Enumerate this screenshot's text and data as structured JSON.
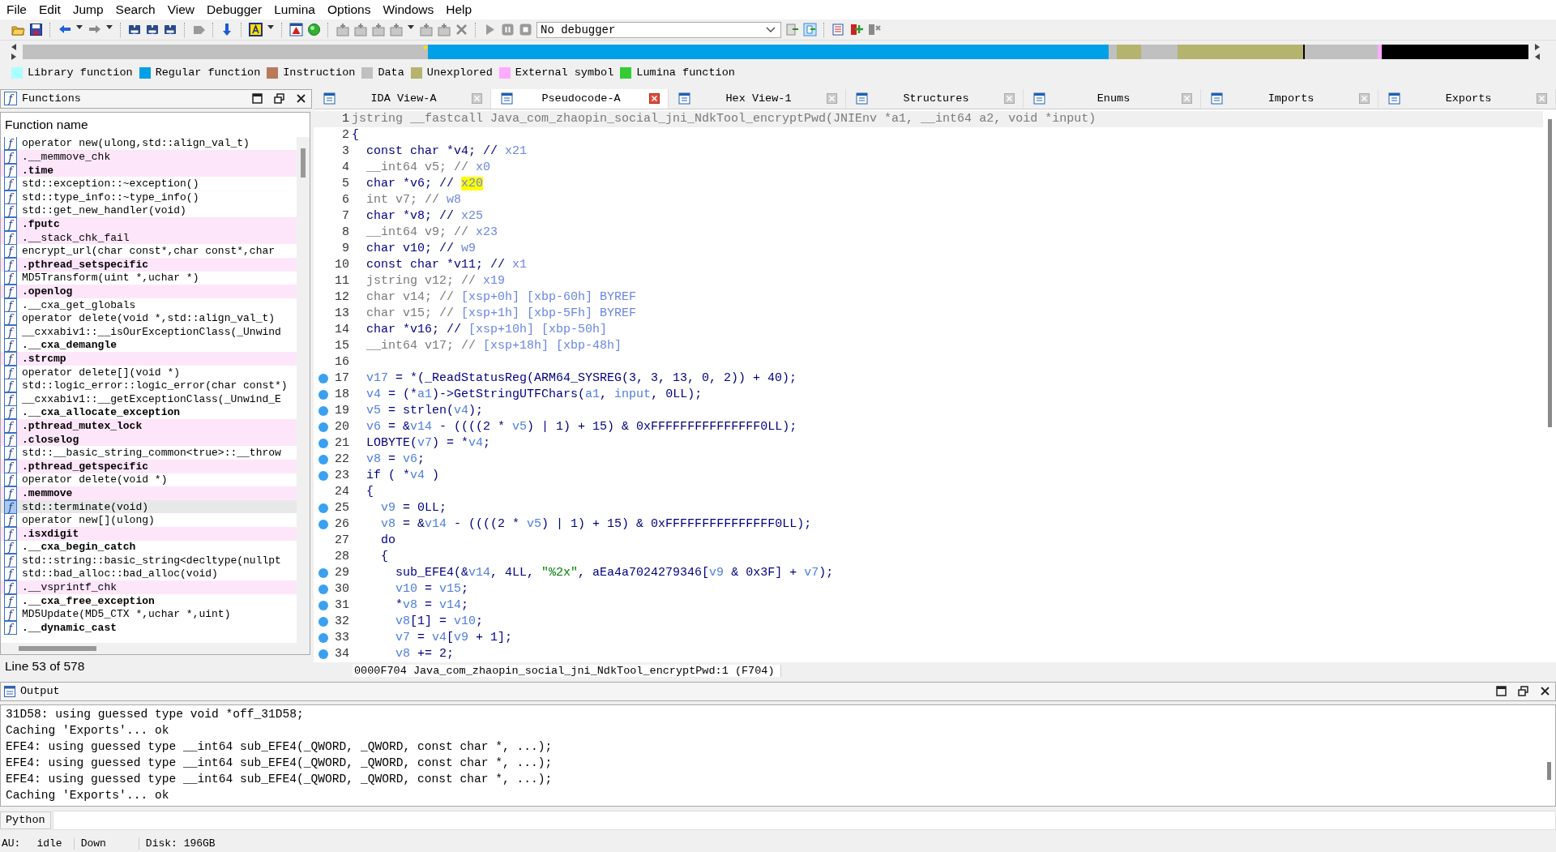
{
  "menu": [
    "File",
    "Edit",
    "Jump",
    "Search",
    "View",
    "Debugger",
    "Lumina",
    "Options",
    "Windows",
    "Help"
  ],
  "toolbar": {
    "debugger_select": "No debugger"
  },
  "legend": [
    {
      "label": "Library function",
      "color": "#aaffff"
    },
    {
      "label": "Regular function",
      "color": "#00a0e6"
    },
    {
      "label": "Instruction",
      "color": "#b87a5a"
    },
    {
      "label": "Data",
      "color": "#c0c0c0"
    },
    {
      "label": "Unexplored",
      "color": "#b4b46e"
    },
    {
      "label": "External symbol",
      "color": "#ffaaff"
    },
    {
      "label": "Lumina function",
      "color": "#33cc33"
    }
  ],
  "functions_panel": {
    "title_icon": "f",
    "title": "Functions",
    "column": "Function name",
    "status": "Line 53 of 578",
    "rows": [
      {
        "icon": "f",
        "name": "operator new(ulong,std::align_val_t)",
        "external": false,
        "bold": false,
        "selected": false
      },
      {
        "icon": "f",
        "name": ".__memmove_chk",
        "external": true,
        "bold": false,
        "selected": false
      },
      {
        "icon": "f",
        "name": ".time",
        "external": true,
        "bold": true,
        "selected": false
      },
      {
        "icon": "f",
        "name": "std::exception::~exception()",
        "external": false,
        "bold": false,
        "selected": false
      },
      {
        "icon": "f",
        "name": "std::type_info::~type_info()",
        "external": false,
        "bold": false,
        "selected": false
      },
      {
        "icon": "f",
        "name": "std::get_new_handler(void)",
        "external": false,
        "bold": false,
        "selected": false
      },
      {
        "icon": "f",
        "name": ".fputc",
        "external": true,
        "bold": true,
        "selected": false
      },
      {
        "icon": "f",
        "name": ".__stack_chk_fail",
        "external": true,
        "bold": false,
        "selected": false
      },
      {
        "icon": "f",
        "name": "encrypt_url(char const*,char const*,char",
        "external": false,
        "bold": false,
        "selected": false
      },
      {
        "icon": "f",
        "name": ".pthread_setspecific",
        "external": true,
        "bold": true,
        "selected": false
      },
      {
        "icon": "f",
        "name": "MD5Transform(uint *,uchar *)",
        "external": false,
        "bold": false,
        "selected": false
      },
      {
        "icon": "f",
        "name": ".openlog",
        "external": true,
        "bold": true,
        "selected": false
      },
      {
        "icon": "f",
        "name": ".__cxa_get_globals",
        "external": false,
        "bold": false,
        "selected": false
      },
      {
        "icon": "f",
        "name": "operator delete(void *,std::align_val_t)",
        "external": false,
        "bold": false,
        "selected": false
      },
      {
        "icon": "f",
        "name": "__cxxabiv1::__isOurExceptionClass(_Unwind",
        "external": false,
        "bold": false,
        "selected": false
      },
      {
        "icon": "f",
        "name": ".__cxa_demangle",
        "external": false,
        "bold": true,
        "selected": false
      },
      {
        "icon": "f",
        "name": ".strcmp",
        "external": true,
        "bold": true,
        "selected": false
      },
      {
        "icon": "f",
        "name": "operator delete[](void *)",
        "external": false,
        "bold": false,
        "selected": false
      },
      {
        "icon": "f",
        "name": "std::logic_error::logic_error(char const*)",
        "external": false,
        "bold": false,
        "selected": false
      },
      {
        "icon": "f",
        "name": "__cxxabiv1::__getExceptionClass(_Unwind_E",
        "external": false,
        "bold": false,
        "selected": false
      },
      {
        "icon": "f",
        "name": ".__cxa_allocate_exception",
        "external": false,
        "bold": true,
        "selected": false
      },
      {
        "icon": "f",
        "name": ".pthread_mutex_lock",
        "external": true,
        "bold": true,
        "selected": false
      },
      {
        "icon": "f",
        "name": ".closelog",
        "external": true,
        "bold": true,
        "selected": false
      },
      {
        "icon": "f",
        "name": "std::__basic_string_common<true>::__throw",
        "external": false,
        "bold": false,
        "selected": false
      },
      {
        "icon": "f",
        "name": ".pthread_getspecific",
        "external": true,
        "bold": true,
        "selected": false
      },
      {
        "icon": "f",
        "name": "operator delete(void *)",
        "external": false,
        "bold": false,
        "selected": false
      },
      {
        "icon": "f",
        "name": ".memmove",
        "external": true,
        "bold": true,
        "selected": false
      },
      {
        "icon": "f",
        "name": "std::terminate(void)",
        "external": false,
        "bold": false,
        "selected": true
      },
      {
        "icon": "f",
        "name": "operator new[](ulong)",
        "external": false,
        "bold": false,
        "selected": false
      },
      {
        "icon": "f",
        "name": ".isxdigit",
        "external": true,
        "bold": true,
        "selected": false
      },
      {
        "icon": "f",
        "name": ".__cxa_begin_catch",
        "external": false,
        "bold": true,
        "selected": false
      },
      {
        "icon": "f",
        "name": "std::string::basic_string<decltype(nullpt",
        "external": false,
        "bold": false,
        "selected": false
      },
      {
        "icon": "f",
        "name": "std::bad_alloc::bad_alloc(void)",
        "external": false,
        "bold": false,
        "selected": false
      },
      {
        "icon": "f",
        "name": ".__vsprintf_chk",
        "external": true,
        "bold": false,
        "selected": false
      },
      {
        "icon": "f",
        "name": ".__cxa_free_exception",
        "external": false,
        "bold": true,
        "selected": false
      },
      {
        "icon": "f",
        "name": "MD5Update(MD5_CTX *,uchar *,uint)",
        "external": false,
        "bold": false,
        "selected": false
      },
      {
        "icon": "f",
        "name": ".__dynamic_cast",
        "external": false,
        "bold": true,
        "selected": false
      }
    ]
  },
  "tabs": [
    {
      "label": "IDA View-A",
      "selected": false
    },
    {
      "label": "Pseudocode-A",
      "selected": true
    },
    {
      "label": "Hex View-1",
      "selected": false
    },
    {
      "label": "Structures",
      "selected": false
    },
    {
      "label": "Enums",
      "selected": false
    },
    {
      "label": "Imports",
      "selected": false
    },
    {
      "label": "Exports",
      "selected": false
    }
  ],
  "pseudocode": {
    "status": "0000F704 Java_com_zhaopin_social_jni_NdkTool_encryptPwd:1 (F704)",
    "lines": [
      {
        "number": "1",
        "breakpoint": false,
        "current": true,
        "segments": [
          {
            "kind": "g",
            "text": "jstring __fastcall Java_com_zhaopin_social_jni_NdkTool_encryptPwd(JNIEnv *a1, __int64 a2, void *input)"
          }
        ]
      },
      {
        "number": "2",
        "breakpoint": false,
        "current": false,
        "segments": [
          {
            "kind": "n",
            "text": "{"
          }
        ]
      },
      {
        "number": "3",
        "breakpoint": false,
        "current": false,
        "segments": [
          {
            "kind": "n",
            "text": "  const char *v4; // "
          },
          {
            "kind": "c",
            "text": "x21"
          }
        ]
      },
      {
        "number": "4",
        "breakpoint": false,
        "current": false,
        "segments": [
          {
            "kind": "g",
            "text": "  __int64 v5; // "
          },
          {
            "kind": "c",
            "text": "x0"
          }
        ]
      },
      {
        "number": "5",
        "breakpoint": false,
        "current": false,
        "segments": [
          {
            "kind": "n",
            "text": "  char *v6; // "
          },
          {
            "kind": "h",
            "text": "x20"
          }
        ]
      },
      {
        "number": "6",
        "breakpoint": false,
        "current": false,
        "segments": [
          {
            "kind": "g",
            "text": "  int v7; // "
          },
          {
            "kind": "c",
            "text": "w8"
          }
        ]
      },
      {
        "number": "7",
        "breakpoint": false,
        "current": false,
        "segments": [
          {
            "kind": "n",
            "text": "  char *v8; // "
          },
          {
            "kind": "c",
            "text": "x25"
          }
        ]
      },
      {
        "number": "8",
        "breakpoint": false,
        "current": false,
        "segments": [
          {
            "kind": "g",
            "text": "  __int64 v9; // "
          },
          {
            "kind": "c",
            "text": "x23"
          }
        ]
      },
      {
        "number": "9",
        "breakpoint": false,
        "current": false,
        "segments": [
          {
            "kind": "n",
            "text": "  char v10; // "
          },
          {
            "kind": "c",
            "text": "w9"
          }
        ]
      },
      {
        "number": "10",
        "breakpoint": false,
        "current": false,
        "segments": [
          {
            "kind": "n",
            "text": "  const char *v11; // "
          },
          {
            "kind": "c",
            "text": "x1"
          }
        ]
      },
      {
        "number": "11",
        "breakpoint": false,
        "current": false,
        "segments": [
          {
            "kind": "g",
            "text": "  jstring v12; // "
          },
          {
            "kind": "c",
            "text": "x19"
          }
        ]
      },
      {
        "number": "12",
        "breakpoint": false,
        "current": false,
        "segments": [
          {
            "kind": "g",
            "text": "  char v14; // "
          },
          {
            "kind": "c",
            "text": "[xsp+0h] [xbp-60h] BYREF"
          }
        ]
      },
      {
        "number": "13",
        "breakpoint": false,
        "current": false,
        "segments": [
          {
            "kind": "g",
            "text": "  char v15; // "
          },
          {
            "kind": "c",
            "text": "[xsp+1h] [xbp-5Fh] BYREF"
          }
        ]
      },
      {
        "number": "14",
        "breakpoint": false,
        "current": false,
        "segments": [
          {
            "kind": "n",
            "text": "  char *v16; // "
          },
          {
            "kind": "c",
            "text": "[xsp+10h] [xbp-50h]"
          }
        ]
      },
      {
        "number": "15",
        "breakpoint": false,
        "current": false,
        "segments": [
          {
            "kind": "g",
            "text": "  __int64 v17; // "
          },
          {
            "kind": "c",
            "text": "[xsp+18h] [xbp-48h]"
          }
        ]
      },
      {
        "number": "16",
        "breakpoint": false,
        "current": false
      },
      {
        "number": "17",
        "breakpoint": true,
        "current": false,
        "segments": [
          {
            "kind": "v",
            "text": "  v17"
          },
          {
            "kind": "n",
            "text": " = *(_ReadStatusReg(ARM64_SYSREG(3, 3, 13, 0, 2)) + 40);"
          }
        ]
      },
      {
        "number": "18",
        "breakpoint": true,
        "current": false,
        "segments": [
          {
            "kind": "v",
            "text": "  v4"
          },
          {
            "kind": "n",
            "text": " = (*"
          },
          {
            "kind": "v",
            "text": "a1"
          },
          {
            "kind": "n",
            "text": ")->GetStringUTFChars("
          },
          {
            "kind": "v",
            "text": "a1"
          },
          {
            "kind": "n",
            "text": ", "
          },
          {
            "kind": "v",
            "text": "input"
          },
          {
            "kind": "n",
            "text": ", 0LL);"
          }
        ]
      },
      {
        "number": "19",
        "breakpoint": true,
        "current": false,
        "segments": [
          {
            "kind": "v",
            "text": "  v5"
          },
          {
            "kind": "n",
            "text": " = strlen("
          },
          {
            "kind": "v",
            "text": "v4"
          },
          {
            "kind": "n",
            "text": ");"
          }
        ]
      },
      {
        "number": "20",
        "breakpoint": true,
        "current": false,
        "segments": [
          {
            "kind": "v",
            "text": "  v6"
          },
          {
            "kind": "n",
            "text": " = &"
          },
          {
            "kind": "v",
            "text": "v14"
          },
          {
            "kind": "n",
            "text": " - ((((2 * "
          },
          {
            "kind": "v",
            "text": "v5"
          },
          {
            "kind": "n",
            "text": ") | 1) + 15) & 0xFFFFFFFFFFFFFFF0LL);"
          }
        ]
      },
      {
        "number": "21",
        "breakpoint": true,
        "current": false,
        "segments": [
          {
            "kind": "n",
            "text": "  LOBYTE("
          },
          {
            "kind": "v",
            "text": "v7"
          },
          {
            "kind": "n",
            "text": ") = *"
          },
          {
            "kind": "v",
            "text": "v4"
          },
          {
            "kind": "n",
            "text": ";"
          }
        ]
      },
      {
        "number": "22",
        "breakpoint": true,
        "current": false,
        "segments": [
          {
            "kind": "v",
            "text": "  v8"
          },
          {
            "kind": "n",
            "text": " = "
          },
          {
            "kind": "v",
            "text": "v6"
          },
          {
            "kind": "n",
            "text": ";"
          }
        ]
      },
      {
        "number": "23",
        "breakpoint": true,
        "current": false,
        "segments": [
          {
            "kind": "n",
            "text": "  if ( *"
          },
          {
            "kind": "v",
            "text": "v4"
          },
          {
            "kind": "n",
            "text": " )"
          }
        ]
      },
      {
        "number": "24",
        "breakpoint": false,
        "current": false,
        "segments": [
          {
            "kind": "n",
            "text": "  {"
          }
        ]
      },
      {
        "number": "25",
        "breakpoint": true,
        "current": false,
        "segments": [
          {
            "kind": "v",
            "text": "    v9"
          },
          {
            "kind": "n",
            "text": " = 0LL;"
          }
        ]
      },
      {
        "number": "26",
        "breakpoint": true,
        "current": false,
        "segments": [
          {
            "kind": "v",
            "text": "    v8"
          },
          {
            "kind": "n",
            "text": " = &"
          },
          {
            "kind": "v",
            "text": "v14"
          },
          {
            "kind": "n",
            "text": " - ((((2 * "
          },
          {
            "kind": "v",
            "text": "v5"
          },
          {
            "kind": "n",
            "text": ") | 1) + 15) & 0xFFFFFFFFFFFFFFF0LL);"
          }
        ]
      },
      {
        "number": "27",
        "breakpoint": false,
        "current": false,
        "segments": [
          {
            "kind": "n",
            "text": "    do"
          }
        ]
      },
      {
        "number": "28",
        "breakpoint": false,
        "current": false,
        "segments": [
          {
            "kind": "n",
            "text": "    {"
          }
        ]
      },
      {
        "number": "29",
        "breakpoint": true,
        "current": false,
        "segments": [
          {
            "kind": "n",
            "text": "      sub_EFE4(&"
          },
          {
            "kind": "v",
            "text": "v14"
          },
          {
            "kind": "n",
            "text": ", 4LL, "
          },
          {
            "kind": "s",
            "text": "\"%2x\""
          },
          {
            "kind": "n",
            "text": ", aEa4a7024279346["
          },
          {
            "kind": "v",
            "text": "v9"
          },
          {
            "kind": "n",
            "text": " & 0x3F] + "
          },
          {
            "kind": "v",
            "text": "v7"
          },
          {
            "kind": "n",
            "text": ");"
          }
        ]
      },
      {
        "number": "30",
        "breakpoint": true,
        "current": false,
        "segments": [
          {
            "kind": "v",
            "text": "      v10"
          },
          {
            "kind": "n",
            "text": " = "
          },
          {
            "kind": "v",
            "text": "v15"
          },
          {
            "kind": "n",
            "text": ";"
          }
        ]
      },
      {
        "number": "31",
        "breakpoint": true,
        "current": false,
        "segments": [
          {
            "kind": "n",
            "text": "      *"
          },
          {
            "kind": "v",
            "text": "v8"
          },
          {
            "kind": "n",
            "text": " = "
          },
          {
            "kind": "v",
            "text": "v14"
          },
          {
            "kind": "n",
            "text": ";"
          }
        ]
      },
      {
        "number": "32",
        "breakpoint": true,
        "current": false,
        "segments": [
          {
            "kind": "v",
            "text": "      v8"
          },
          {
            "kind": "n",
            "text": "[1] = "
          },
          {
            "kind": "v",
            "text": "v10"
          },
          {
            "kind": "n",
            "text": ";"
          }
        ]
      },
      {
        "number": "33",
        "breakpoint": true,
        "current": false,
        "segments": [
          {
            "kind": "v",
            "text": "      v7"
          },
          {
            "kind": "n",
            "text": " = "
          },
          {
            "kind": "v",
            "text": "v4"
          },
          {
            "kind": "n",
            "text": "["
          },
          {
            "kind": "v",
            "text": "v9"
          },
          {
            "kind": "n",
            "text": " + 1];"
          }
        ]
      },
      {
        "number": "34",
        "breakpoint": true,
        "current": false,
        "segments": [
          {
            "kind": "v",
            "text": "      v8"
          },
          {
            "kind": "n",
            "text": " += 2;"
          }
        ]
      }
    ]
  },
  "output": {
    "title": "Output",
    "lines": [
      "31D58: using guessed type void *off_31D58;",
      "Caching 'Exports'... ok",
      "EFE4: using guessed type __int64 sub_EFE4(_QWORD, _QWORD, const char *, ...);",
      "EFE4: using guessed type __int64 sub_EFE4(_QWORD, _QWORD, const char *, ...);",
      "EFE4: using guessed type __int64 sub_EFE4(_QWORD, _QWORD, const char *, ...);",
      "Caching 'Exports'... ok"
    ],
    "interpreter": "Python"
  },
  "status_bar": [
    "AU:",
    "idle",
    "Down",
    "Disk: 196GB"
  ]
}
